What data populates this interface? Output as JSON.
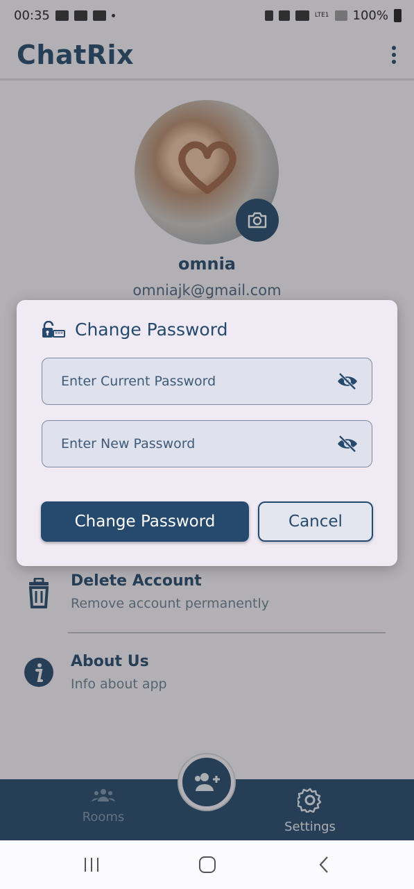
{
  "status_bar": {
    "time": "00:35",
    "battery": "100%",
    "network": "LTE1"
  },
  "app_bar": {
    "title": "ChatRix"
  },
  "profile": {
    "name": "omnia",
    "email": "omniajk@gmail.com"
  },
  "settings": {
    "items": [
      {
        "title": "Delete Account",
        "subtitle": "Remove account permanently",
        "icon": "trash-icon"
      },
      {
        "title": "About Us",
        "subtitle": "Info about app",
        "icon": "info-icon"
      }
    ]
  },
  "bottom_nav": {
    "items": [
      {
        "label": "Rooms",
        "icon": "rooms-icon"
      },
      {
        "label": "Settings",
        "icon": "gear-icon"
      }
    ],
    "fab_icon": "add-person-icon"
  },
  "dialog": {
    "title": "Change Password",
    "current_password_placeholder": "Enter Current Password",
    "new_password_placeholder": "Enter New Password",
    "confirm_label": "Change Password",
    "cancel_label": "Cancel"
  },
  "colors": {
    "primary": "#264a6e",
    "dialog_bg": "#efeaf3",
    "field_bg": "#dfe2ec"
  }
}
